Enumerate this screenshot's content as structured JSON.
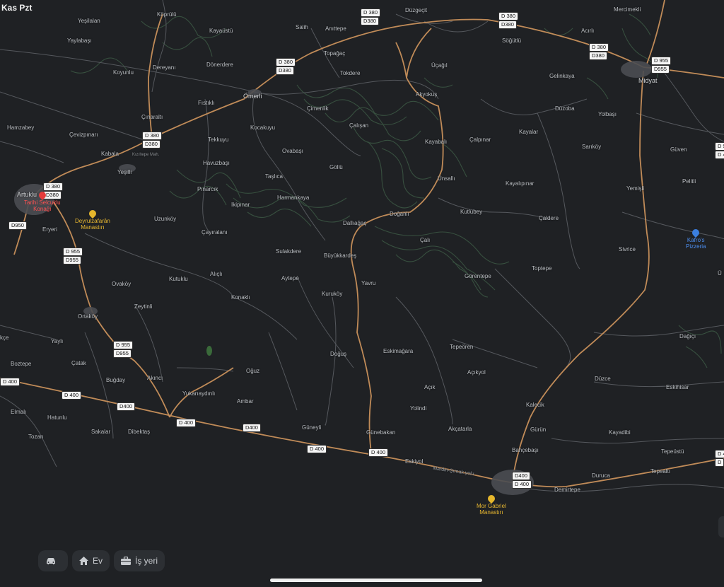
{
  "status": {
    "time_day": "Kas Pzt"
  },
  "colors": {
    "background": "#1f2124",
    "major_road": "#c58f5b",
    "minor_road": "#5a5d61",
    "relief": "#3f5a45",
    "label": "#b9bdc2"
  },
  "places": [
    {
      "name": "Köprülü"
    },
    {
      "name": "Yeşilalan"
    },
    {
      "name": "Yaylabaşı"
    },
    {
      "name": "Koyunlu"
    },
    {
      "name": "Dereyanı"
    },
    {
      "name": "Kayaüstü"
    },
    {
      "name": "Salih"
    },
    {
      "name": "Anıttepe"
    },
    {
      "name": "Düzgeçit"
    },
    {
      "name": "Mercimekli"
    },
    {
      "name": "Acırlı"
    },
    {
      "name": "Söğütlü"
    },
    {
      "name": "Topağaç"
    },
    {
      "name": "Dönerdere"
    },
    {
      "name": "Tokdere"
    },
    {
      "name": "Üçağıl"
    },
    {
      "name": "Gelinkaya"
    },
    {
      "name": "Fıstıklı"
    },
    {
      "name": "Ömerli"
    },
    {
      "name": "Akyokuş"
    },
    {
      "name": "Midyat"
    },
    {
      "name": "Düzoba"
    },
    {
      "name": "Hamzabey"
    },
    {
      "name": "Çınaraltı"
    },
    {
      "name": "Çimenlik"
    },
    {
      "name": "Yolbaşı"
    },
    {
      "name": "Kocakuyu"
    },
    {
      "name": "Çalışan"
    },
    {
      "name": "Kayalar"
    },
    {
      "name": "Çevizpınarı"
    },
    {
      "name": "Tekkuyu"
    },
    {
      "name": "Çalpınar"
    },
    {
      "name": "Kabala"
    },
    {
      "name": "Kayabalı"
    },
    {
      "name": "Sarıköy"
    },
    {
      "name": "Güven"
    },
    {
      "name": "Ovabaşı"
    },
    {
      "name": "Havuzbaşı"
    },
    {
      "name": "Göllü"
    },
    {
      "name": "Yeşilli"
    },
    {
      "name": "Taşlıca"
    },
    {
      "name": "Ünsallı"
    },
    {
      "name": "Pelitli"
    },
    {
      "name": "Kayalıpınar"
    },
    {
      "name": "Yemişli"
    },
    {
      "name": "Pınarcık"
    },
    {
      "name": "Harmankaya"
    },
    {
      "name": "Artuklu"
    },
    {
      "name": "Kutlubey"
    },
    {
      "name": "Doğanlı"
    },
    {
      "name": "Eryeri"
    },
    {
      "name": "Uzunköy"
    },
    {
      "name": "Çaldere"
    },
    {
      "name": "Ikipınar"
    },
    {
      "name": "Dallıağaç"
    },
    {
      "name": "Çayıralanı"
    },
    {
      "name": "Çalı"
    },
    {
      "name": "Sivrice"
    },
    {
      "name": "Sulakdere"
    },
    {
      "name": "Büyükkardeş"
    },
    {
      "name": "Toptepe"
    },
    {
      "name": "Alıçlı"
    },
    {
      "name": "Görentepe"
    },
    {
      "name": "Ovaköy"
    },
    {
      "name": "Kutuklu"
    },
    {
      "name": "Aytepe"
    },
    {
      "name": "Yavru"
    },
    {
      "name": "Konaklı"
    },
    {
      "name": "Kuruköy"
    },
    {
      "name": "Zeytinli"
    },
    {
      "name": "Ortaköy"
    },
    {
      "name": "Dağıçı"
    },
    {
      "name": "Yaylı"
    },
    {
      "name": "Tepeören"
    },
    {
      "name": "Eskimağara"
    },
    {
      "name": "Doğuş"
    },
    {
      "name": "Çatak"
    },
    {
      "name": "Boztepe"
    },
    {
      "name": "Açıkyol"
    },
    {
      "name": "Oğuz"
    },
    {
      "name": "Düzce"
    },
    {
      "name": "Buğday"
    },
    {
      "name": "Akıncı"
    },
    {
      "name": "Eskihisar"
    },
    {
      "name": "Açık"
    },
    {
      "name": "Yukarıaydınlı"
    },
    {
      "name": "Kalecik"
    },
    {
      "name": "Ambar"
    },
    {
      "name": "Yolindi"
    },
    {
      "name": "Elmalı"
    },
    {
      "name": "Hatunlu"
    },
    {
      "name": "Güneyli"
    },
    {
      "name": "Akçatarla"
    },
    {
      "name": "Gürün"
    },
    {
      "name": "Sakalar"
    },
    {
      "name": "Dibektaş"
    },
    {
      "name": "Günebakan"
    },
    {
      "name": "Kayadibi"
    },
    {
      "name": "Tozan"
    },
    {
      "name": "Bahçebaşı"
    },
    {
      "name": "Tepeüstü"
    },
    {
      "name": "Eskiyol"
    },
    {
      "name": "Duruca"
    },
    {
      "name": "Tepealtı"
    },
    {
      "name": "Demirtepe"
    },
    {
      "name": "Kızıltepe Mah."
    },
    {
      "name": "Mardin-Şırnak yolu"
    },
    {
      "name": "Ü"
    },
    {
      "name": "kçe"
    }
  ],
  "shields": [
    "D 380",
    "D380",
    "D 380",
    "D380",
    "D 380",
    "D380",
    "D 380",
    "D380",
    "D 380",
    "D380",
    "D 380",
    "D380",
    "D 955",
    "D955",
    "D 955",
    "D955",
    "D 955",
    "D955",
    "D950",
    "D 400",
    "D 400",
    "D400",
    "D 400",
    "D400",
    "D 400",
    "D 400",
    "D400",
    "D 400",
    "D 400",
    "D 955",
    "D 4",
    "D"
  ],
  "pois": [
    {
      "name": "Tarihi Selcuklu\nKonağı",
      "color": "red"
    },
    {
      "name": "Deyrulzafarân\nManastırı",
      "color": "yellow"
    },
    {
      "name": "Kafro's\nPizzeria",
      "color": "blue"
    },
    {
      "name": "Mor Gabriel\nManastırı",
      "color": "yellow"
    }
  ],
  "bottom_bar": {
    "car_label": "",
    "home_label": "Ev",
    "work_label": "İş yeri"
  }
}
